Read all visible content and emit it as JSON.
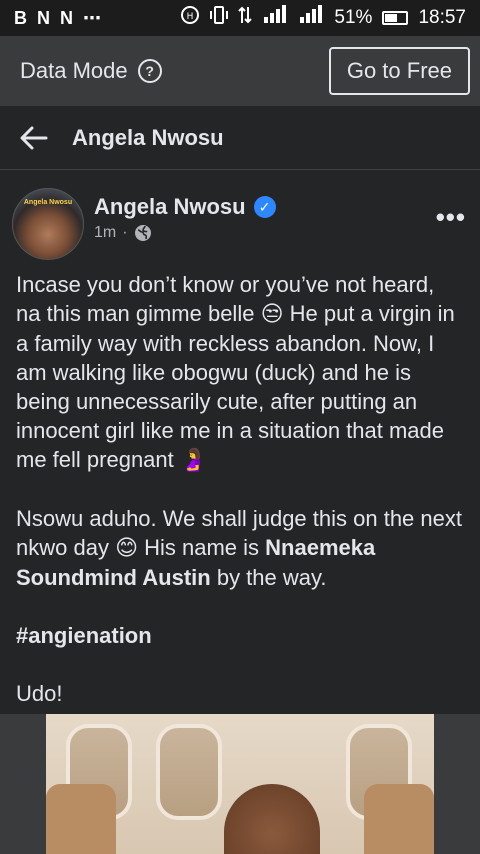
{
  "status_bar": {
    "left_icons": [
      "B",
      "N",
      "N",
      "⋯"
    ],
    "battery_percent": "51%",
    "battery_level": 0.51,
    "time": "18:57"
  },
  "data_mode": {
    "label": "Data Mode",
    "button": "Go to Free"
  },
  "header": {
    "title": "Angela Nwosu"
  },
  "post": {
    "author": "Angela Nwosu",
    "verified": true,
    "time": "1m",
    "separator": "·",
    "avatar_text": "Angela Nwosu",
    "paragraph1_a": "Incase you don’t know or you’ve not heard, na this man gimme belle ",
    "paragraph1_emoji1": "😒",
    "paragraph1_b": " He put a virgin in a family way with reckless abandon. Now, I am walking like obogwu (duck) and he is being unnecessarily cute, after putting an innocent girl like me in a situation that made me fell pregnant ",
    "paragraph1_emoji2": "🤰",
    "paragraph2_a": "Nsowu aduho. We shall judge this on the next nkwo day ",
    "paragraph2_emoji": "😊",
    "paragraph2_b": " His name is ",
    "paragraph2_bold": "Nnaemeka Soundmind Austin",
    "paragraph2_c": " by the way.",
    "hashtag": "#angienation",
    "closing": "Udo!"
  },
  "colors": {
    "background": "#242526",
    "bar": "#3a3b3c",
    "text": "#e4e6eb",
    "muted": "#b0b3b8",
    "verified": "#2d88ff"
  },
  "icons": [
    "back-arrow-icon",
    "help-icon",
    "verified-icon",
    "globe-icon",
    "more-icon",
    "battery-icon",
    "signal-icon",
    "wifi-icon"
  ]
}
